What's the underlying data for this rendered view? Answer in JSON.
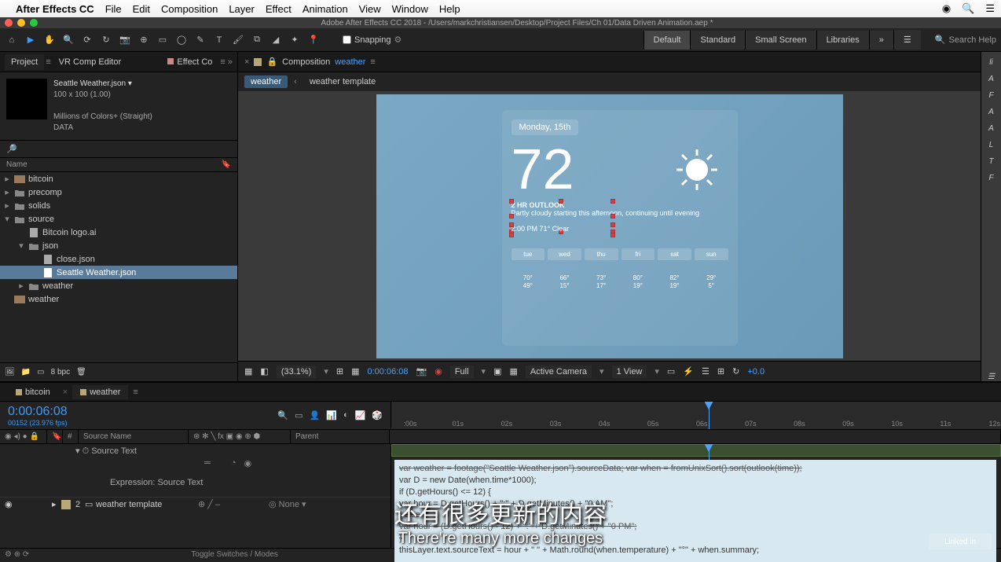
{
  "mac_menu": {
    "app": "After Effects CC",
    "items": [
      "File",
      "Edit",
      "Composition",
      "Layer",
      "Effect",
      "Animation",
      "View",
      "Window",
      "Help"
    ]
  },
  "window_title": "Adobe After Effects CC 2018 - /Users/markchristiansen/Desktop/Project Files/Ch 01/Data Driven Animation.aep *",
  "snapping_label": "Snapping",
  "workspaces": [
    "Default",
    "Standard",
    "Small Screen",
    "Libraries"
  ],
  "search_help_placeholder": "Search Help",
  "left_panel": {
    "tabs": [
      "Project",
      "VR Comp Editor"
    ],
    "effect_tab": "Effect Co",
    "asset": {
      "name": "Seattle Weather.json ▾",
      "dims": "100 x 100 (1.00)",
      "colors": "Millions of Colors+ (Straight)",
      "type": "DATA"
    },
    "search_placeholder": "",
    "col_name": "Name",
    "tree": [
      {
        "indent": 0,
        "arrow": "▾",
        "type": "comp",
        "label": "bitcoin"
      },
      {
        "indent": 0,
        "arrow": "▸",
        "type": "folder",
        "label": "precomp"
      },
      {
        "indent": 0,
        "arrow": "▸",
        "type": "folder",
        "label": "solids"
      },
      {
        "indent": 0,
        "arrow": "▾",
        "type": "folder",
        "label": "source"
      },
      {
        "indent": 1,
        "arrow": "",
        "type": "file",
        "label": "Bitcoin logo.ai"
      },
      {
        "indent": 1,
        "arrow": "▾",
        "type": "folder",
        "label": "json"
      },
      {
        "indent": 2,
        "arrow": "",
        "type": "file",
        "label": "close.json"
      },
      {
        "indent": 2,
        "arrow": "",
        "type": "file",
        "label": "Seattle Weather.json",
        "selected": true
      },
      {
        "indent": 1,
        "arrow": "▸",
        "type": "folder",
        "label": "weather"
      },
      {
        "indent": 0,
        "arrow": "",
        "type": "comp",
        "label": "weather"
      }
    ],
    "bpc": "8 bpc"
  },
  "comp_panel": {
    "label": "Composition",
    "name": "weather",
    "breadcrumb": [
      {
        "t": "weather",
        "active": true
      },
      {
        "t": "weather template"
      }
    ]
  },
  "weather": {
    "date": "Monday, 15th",
    "temp": "72",
    "outlook_hdr": "2 HR OUTLOOK",
    "outlook_body": "Partly cloudy starting this afternoon, continuing until evening",
    "hourly": "2:00 PM 71° Clear",
    "days": [
      "tue",
      "wed",
      "thu",
      "fri",
      "sat",
      "sun"
    ],
    "hitemps": [
      "70°",
      "66°",
      "73°",
      "80°",
      "82°",
      "29°"
    ],
    "lotemps": [
      "49°",
      "15°",
      "17°",
      "19°",
      "19°",
      "5°"
    ]
  },
  "viewer_footer": {
    "zoom": "(33.1%)",
    "time": "0:00:06:08",
    "res": "Full",
    "camera": "Active Camera",
    "views": "1 View",
    "exposure": "+0.0"
  },
  "right_strip": [
    "li",
    "A",
    "F",
    "A",
    "A",
    "L",
    "T",
    "F"
  ],
  "timeline": {
    "tabs": [
      {
        "t": "bitcoin"
      },
      {
        "t": "weather",
        "active": true
      }
    ],
    "timecode": "0:00:06:08",
    "subcode": "00152 (23.976 fps)",
    "ruler": [
      ":00s",
      "01s",
      "02s",
      "03s",
      "04s",
      "05s",
      "06s",
      "07s",
      "08s",
      "09s",
      "10s",
      "11s",
      "12s"
    ],
    "col_source": "Source Name",
    "col_parent": "Parent",
    "prop_name": "Source Text",
    "expr_label": "Expression: Source Text",
    "layer2_num": "2",
    "layer2_name": "weather template",
    "layer2_parent": "None",
    "toggle": "Toggle Switches / Modes",
    "expr_lines": [
      "var weather = footage(\"Seattle Weather.json\").sourceData;",
      "var when = fromUnixSort().sort(outlook(time));",
      "var D = new Date(when.time*1000);",
      "if (D.getHours() <= 12) {",
      "var hour = D.getHours() + \":\" + D.getMinutes() + \"0 AM\";",
      "} else {",
      "var hour = (D.getHours() - 12) + \":\" + D.getMinutes() + \"0 PM\";",
      "}",
      "thisLayer.text.sourceText = hour + \" \" + Math.round(when.temperature) + \"°\" + when.summary;"
    ]
  },
  "subtitle": {
    "cn": "还有很多更新的内容",
    "en": "There're many more changes"
  },
  "linkedin": "Linked in"
}
